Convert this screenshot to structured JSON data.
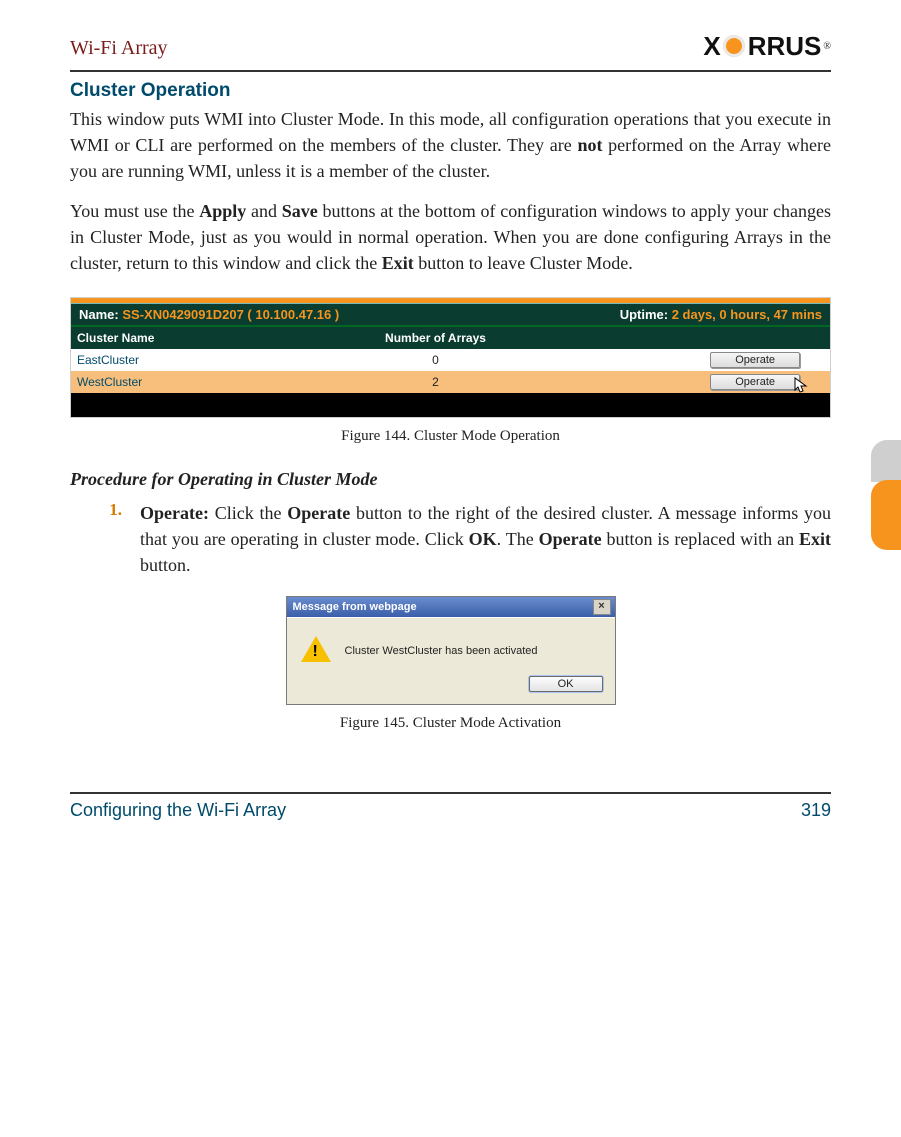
{
  "header": {
    "title": "Wi-Fi Array",
    "logo_text": "RRUS",
    "logo_x": "X",
    "logo_reg": "®"
  },
  "section": {
    "title": "Cluster Operation",
    "p1_a": "This window puts WMI into Cluster Mode. In this mode, all configuration operations that you execute in WMI or CLI are performed on the members of the cluster. They are ",
    "p1_b": "not",
    "p1_c": " performed on the Array where you are running WMI, unless it is a member of the cluster.",
    "p2_a": "You must use the ",
    "p2_b": "Apply",
    "p2_c": " and ",
    "p2_d": "Save",
    "p2_e": " buttons at the bottom of configuration windows to apply your changes in Cluster Mode, just as you would in normal operation. When you are done configuring Arrays in the cluster, return to this window and click the ",
    "p2_f": "Exit",
    "p2_g": " button to leave Cluster Mode."
  },
  "fig144": {
    "name_label": "Name:",
    "name_value": "SS-XN0429091D207   ( 10.100.47.16 )",
    "uptime_label": "Uptime:",
    "uptime_value": "2 days, 0 hours, 47 mins",
    "col_cluster": "Cluster Name",
    "col_num": "Number of Arrays",
    "rows": [
      {
        "name": "EastCluster",
        "count": "0",
        "btn": "Operate"
      },
      {
        "name": "WestCluster",
        "count": "2",
        "btn": "Operate"
      }
    ],
    "caption": "Figure 144. Cluster Mode Operation"
  },
  "procedure": {
    "heading": "Procedure for Operating in Cluster Mode",
    "step_num": "1.",
    "s1_a": "Operate:",
    "s1_b": " Click the ",
    "s1_c": "Operate",
    "s1_d": " button to the right of the desired cluster. A message informs you that you are operating in cluster mode. Click ",
    "s1_e": "OK",
    "s1_f": ". The ",
    "s1_g": "Operate",
    "s1_h": " button is replaced with an ",
    "s1_i": "Exit",
    "s1_j": " button."
  },
  "fig145": {
    "titlebar": "Message from webpage",
    "close": "×",
    "message": "Cluster WestCluster has been activated",
    "ok": "OK",
    "caption": "Figure 145. Cluster Mode Activation"
  },
  "footer": {
    "left": "Configuring the Wi-Fi Array",
    "page": "319"
  }
}
